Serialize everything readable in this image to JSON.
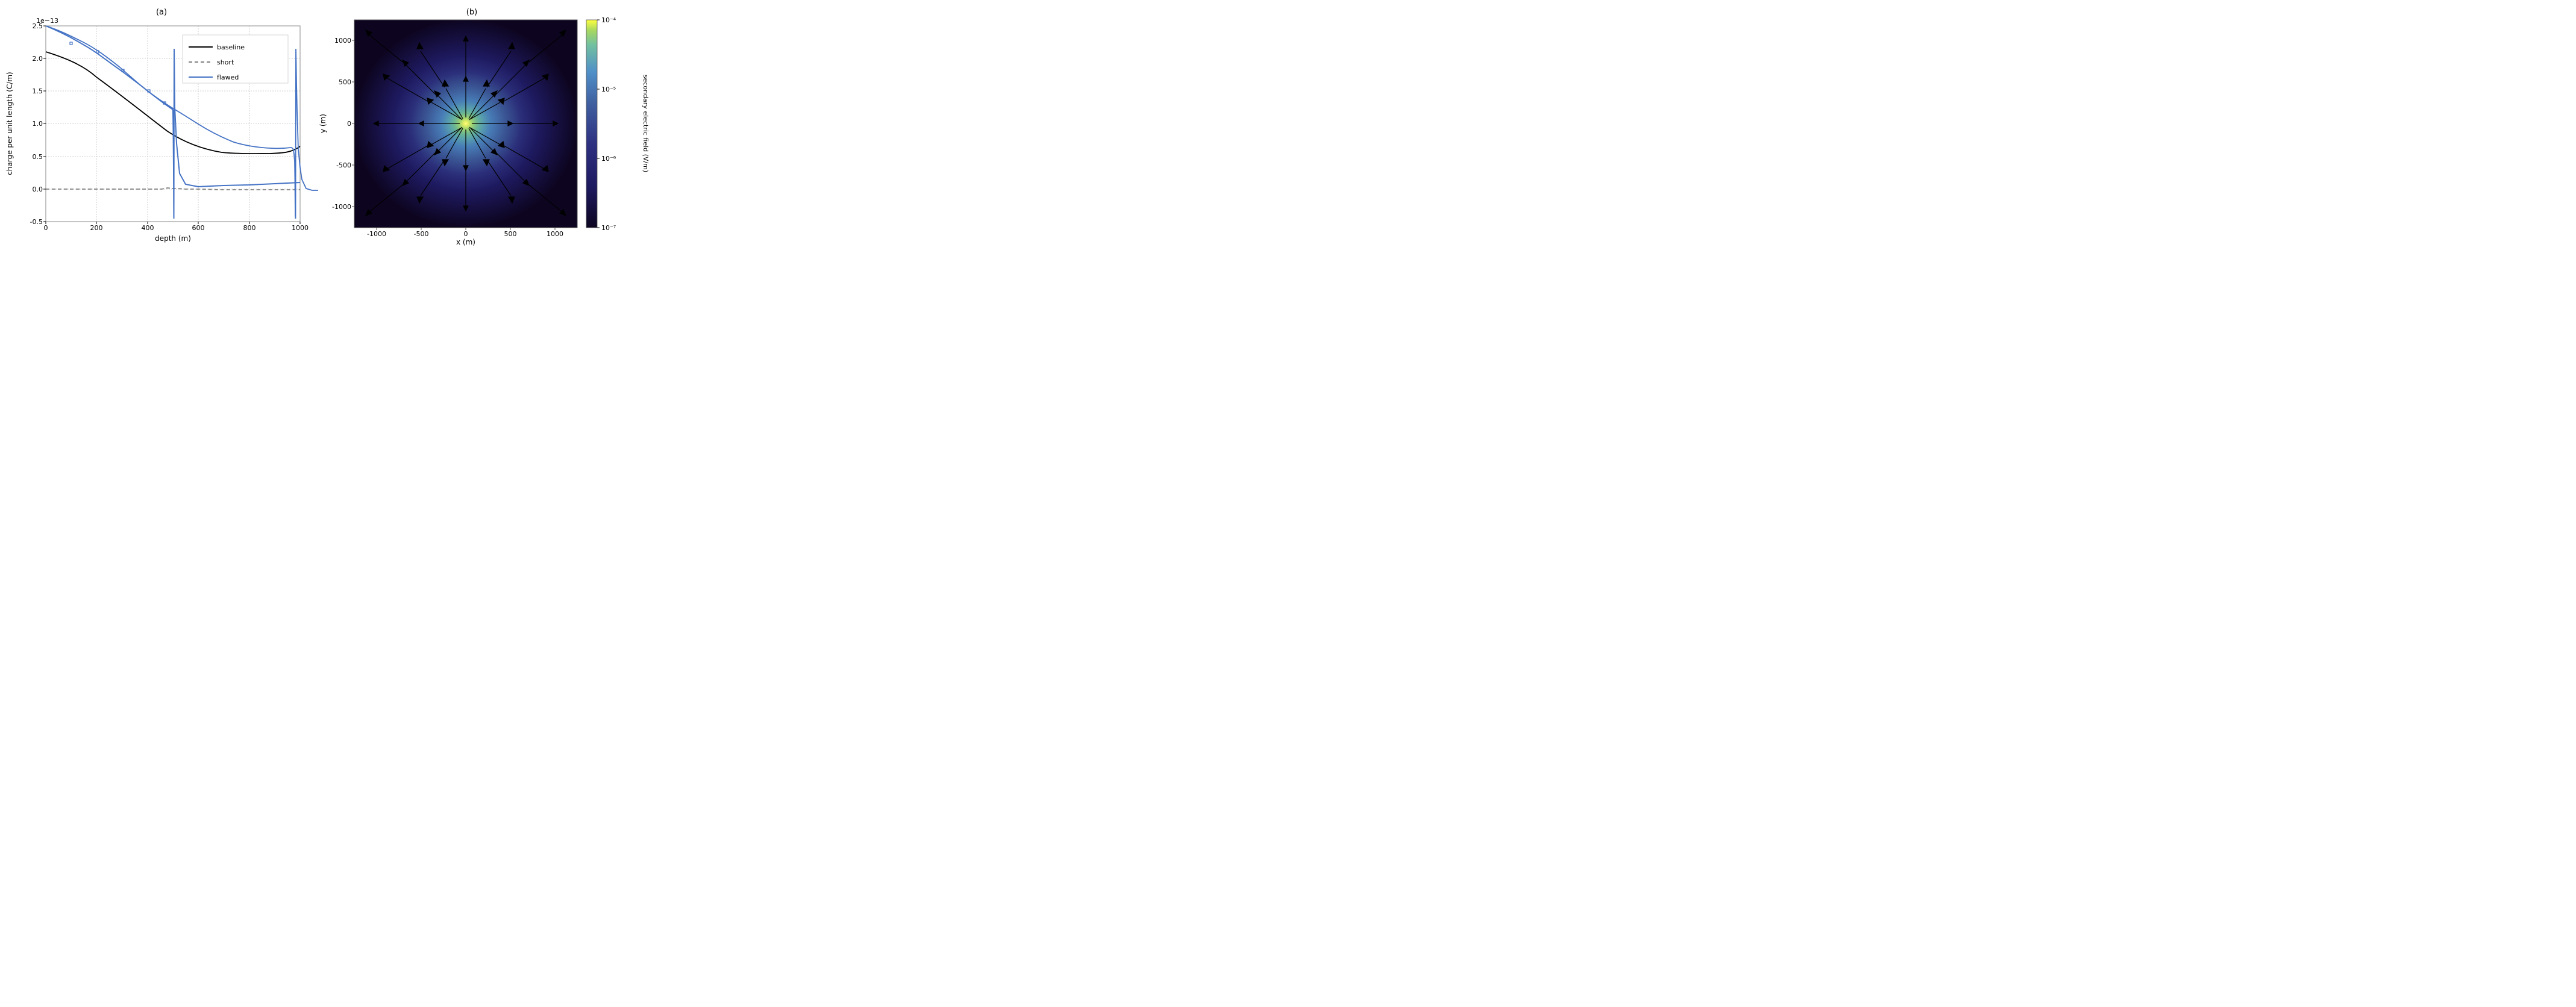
{
  "plot_a": {
    "title": "(a)",
    "x_label": "depth (m)",
    "y_label": "charge per unit length (C/m)",
    "y_scale_note": "1e-13",
    "x_ticks": [
      "0",
      "200",
      "400",
      "600",
      "800",
      "1000"
    ],
    "y_ticks": [
      "-0.5",
      "0.0",
      "0.5",
      "1.0",
      "1.5",
      "2.0",
      "2.5"
    ],
    "legend": {
      "baseline": "baseline",
      "short": "short",
      "flawed": "flawed"
    }
  },
  "plot_b": {
    "title": "(b)",
    "x_label": "x (m)",
    "y_label": "y (m)",
    "x_ticks": [
      "-1000",
      "-500",
      "0",
      "500",
      "1000"
    ],
    "y_ticks": [
      "-1000",
      "-500",
      "0",
      "500",
      "1000"
    ],
    "colorbar_label": "secondary electric field (V/m)",
    "colorbar_ticks": [
      "10⁻⁷",
      "10⁻⁶",
      "10⁻⁵",
      "10⁻⁴"
    ]
  }
}
